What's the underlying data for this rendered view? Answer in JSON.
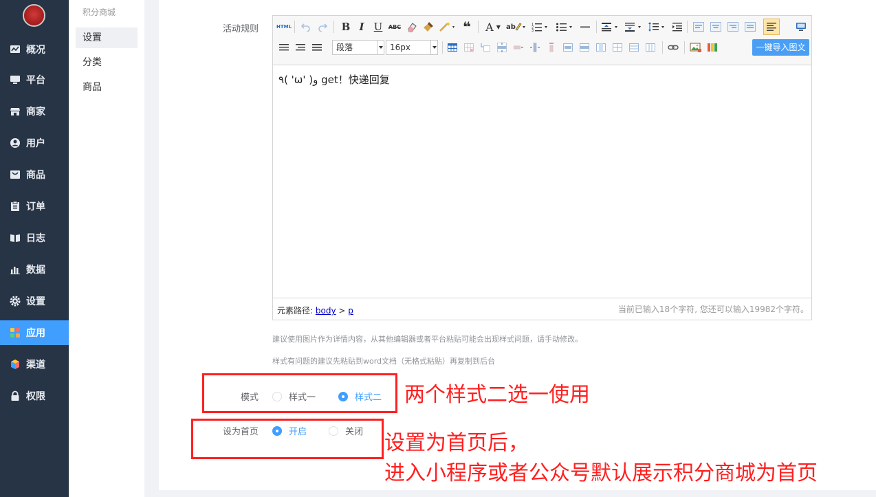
{
  "nav": {
    "items": [
      {
        "label": "概况",
        "icon": "dashboard-icon"
      },
      {
        "label": "平台",
        "icon": "monitor-icon"
      },
      {
        "label": "商家",
        "icon": "store-icon"
      },
      {
        "label": "用户",
        "icon": "user-icon"
      },
      {
        "label": "商品",
        "icon": "goods-icon"
      },
      {
        "label": "订单",
        "icon": "order-icon"
      },
      {
        "label": "日志",
        "icon": "log-icon"
      },
      {
        "label": "数据",
        "icon": "chart-icon"
      },
      {
        "label": "设置",
        "icon": "gear-icon"
      },
      {
        "label": "应用",
        "icon": "apps-icon"
      },
      {
        "label": "渠道",
        "icon": "cube-icon"
      },
      {
        "label": "权限",
        "icon": "lock-icon"
      }
    ],
    "active": "应用"
  },
  "subnav": {
    "title": "积分商城",
    "items": [
      "设置",
      "分类",
      "商品"
    ],
    "active": "设置"
  },
  "form": {
    "rules_label": "活动规则",
    "editor": {
      "html_button": "HTML",
      "bold": "B",
      "italic": "I",
      "underline": "U",
      "strike": "ABC",
      "quote": "❝",
      "font_color": "A",
      "para_select": "段落",
      "size_select": "16px",
      "import_button": "一键导入图文",
      "content": "٩( 'ω' )و get！快递回复",
      "path_label": "元素路径:",
      "path_body": "body",
      "path_sep": ">",
      "path_p": "p",
      "count": "当前已输入18个字符, 您还可以输入19982个字符。"
    },
    "tip1": "建议使用图片作为详情内容，从其他编辑器或者平台粘贴可能会出现样式问题，请手动修改。",
    "tip2": "样式有问题的建议先粘贴到word文档（无格式粘贴）再复制到后台",
    "mode": {
      "label": "模式",
      "options": [
        "样式一",
        "样式二"
      ],
      "selected": "样式二"
    },
    "homepage": {
      "label": "设为首页",
      "options": [
        "开启",
        "关闭"
      ],
      "selected": "开启"
    }
  },
  "annotations": {
    "note1": "两个样式二选一使用",
    "note2_line1": "设置为首页后，",
    "note2_line2": "进入小程序或者公众号默认展示积分商城为首页",
    "color": "#ff1f1f"
  },
  "colors": {
    "nav_bg": "#263445",
    "accent": "#409eff"
  }
}
